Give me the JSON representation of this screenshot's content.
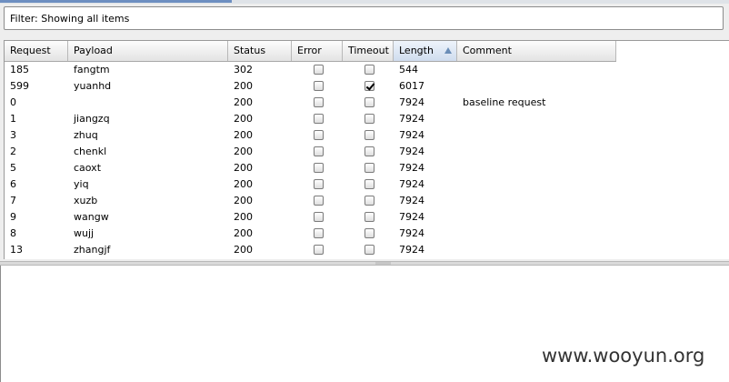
{
  "filter": {
    "text": "Filter: Showing all items"
  },
  "table": {
    "columns": [
      {
        "key": "request",
        "label": "Request"
      },
      {
        "key": "payload",
        "label": "Payload"
      },
      {
        "key": "status",
        "label": "Status"
      },
      {
        "key": "error",
        "label": "Error"
      },
      {
        "key": "timeout",
        "label": "Timeout"
      },
      {
        "key": "length",
        "label": "Length",
        "sorted": "ascending"
      },
      {
        "key": "comment",
        "label": "Comment"
      }
    ],
    "rows": [
      {
        "request": "185",
        "payload": "fangtm",
        "status": "302",
        "error": false,
        "timeout": false,
        "length": "544",
        "comment": ""
      },
      {
        "request": "599",
        "payload": "yuanhd",
        "status": "200",
        "error": false,
        "timeout": true,
        "length": "6017",
        "comment": ""
      },
      {
        "request": "0",
        "payload": "",
        "status": "200",
        "error": false,
        "timeout": false,
        "length": "7924",
        "comment": "baseline request"
      },
      {
        "request": "1",
        "payload": "jiangzq",
        "status": "200",
        "error": false,
        "timeout": false,
        "length": "7924",
        "comment": ""
      },
      {
        "request": "3",
        "payload": "zhuq",
        "status": "200",
        "error": false,
        "timeout": false,
        "length": "7924",
        "comment": ""
      },
      {
        "request": "2",
        "payload": "chenkl",
        "status": "200",
        "error": false,
        "timeout": false,
        "length": "7924",
        "comment": ""
      },
      {
        "request": "5",
        "payload": "caoxt",
        "status": "200",
        "error": false,
        "timeout": false,
        "length": "7924",
        "comment": ""
      },
      {
        "request": "6",
        "payload": "yiq",
        "status": "200",
        "error": false,
        "timeout": false,
        "length": "7924",
        "comment": ""
      },
      {
        "request": "7",
        "payload": "xuzb",
        "status": "200",
        "error": false,
        "timeout": false,
        "length": "7924",
        "comment": ""
      },
      {
        "request": "9",
        "payload": "wangw",
        "status": "200",
        "error": false,
        "timeout": false,
        "length": "7924",
        "comment": ""
      },
      {
        "request": "8",
        "payload": "wujj",
        "status": "200",
        "error": false,
        "timeout": false,
        "length": "7924",
        "comment": ""
      },
      {
        "request": "13",
        "payload": "zhangjf",
        "status": "200",
        "error": false,
        "timeout": false,
        "length": "7924",
        "comment": ""
      }
    ]
  },
  "watermark": {
    "text": "www.wooyun.org"
  }
}
